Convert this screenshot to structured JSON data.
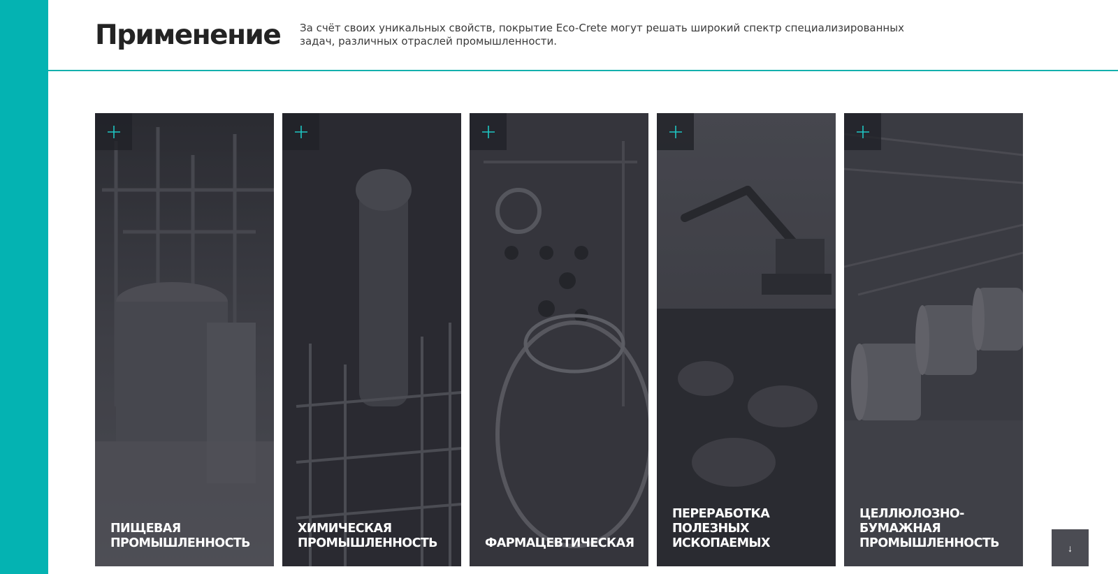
{
  "header": {
    "title": "Применение",
    "description": "За счёт своих уникальных свойств, покрытие Eco-Crete могут решать широкий спектр специализированных задач, различных отраслей промышленности."
  },
  "colors": {
    "accent": "#04b3b2",
    "card_bg": "#33343a",
    "title_text": "#232323"
  },
  "cards": [
    {
      "title": "ПИЩЕВАЯ\nПРОМЫШЛЕННОСТЬ",
      "icon": "plus-icon",
      "image": "food-industry-tanks-photo"
    },
    {
      "title": "ХИМИЧЕСКАЯ\nПРОМЫШЛЕННОСТЬ",
      "icon": "plus-icon",
      "image": "chemical-plant-column-photo"
    },
    {
      "title": "ФАРМАЦЕВТИЧЕСКАЯ",
      "icon": "plus-icon",
      "image": "pharmaceutical-equipment-photo"
    },
    {
      "title": "ПЕРЕРАБОТКА\nПОЛЕЗНЫХ\nИСКОПАЕМЫХ",
      "icon": "plus-icon",
      "image": "mining-excavator-photo"
    },
    {
      "title": "ЦЕЛЛЮЛОЗНО-\nБУМАЖНАЯ\nПРОМЫШЛЕННОСТЬ",
      "icon": "plus-icon",
      "image": "paper-mill-rolls-photo"
    }
  ],
  "scroll_button": {
    "icon": "arrow-down-icon",
    "glyph": "↓"
  }
}
